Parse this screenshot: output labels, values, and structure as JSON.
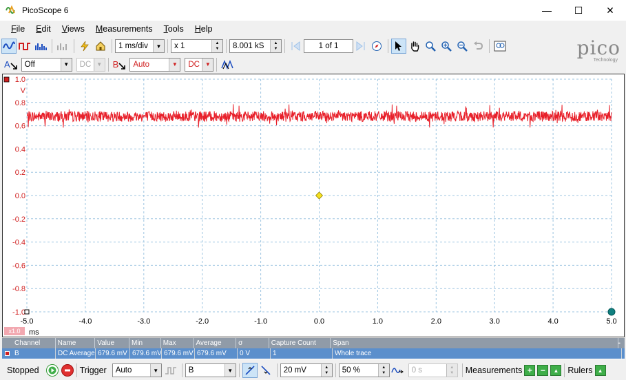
{
  "window": {
    "title": "PicoScope 6",
    "minimize": "—",
    "maximize": "☐",
    "close": "✕"
  },
  "menu": [
    {
      "label": "File",
      "u": "F",
      "rest": "ile"
    },
    {
      "label": "Edit",
      "u": "E",
      "rest": "dit"
    },
    {
      "label": "Views",
      "u": "V",
      "rest": "iews"
    },
    {
      "label": "Measurements",
      "u": "M",
      "rest": "easurements"
    },
    {
      "label": "Tools",
      "u": "T",
      "rest": "ools"
    },
    {
      "label": "Help",
      "u": "H",
      "rest": "elp"
    }
  ],
  "toolbar": {
    "timebase": "1 ms/div",
    "zoom": "x 1",
    "samples": "8.001 kS",
    "capture_index": "1 of 1"
  },
  "channels": {
    "a_label": "A",
    "a_range": "Off",
    "a_coupling": "DC",
    "b_label": "B",
    "b_range": "Auto",
    "b_coupling": "DC"
  },
  "logo": {
    "word": "pico",
    "sub": "Technology"
  },
  "scope": {
    "y_unit": "V",
    "y_ticks": [
      "1.0",
      "0.8",
      "0.6",
      "0.4",
      "0.2",
      "0.0",
      "-0.2",
      "-0.4",
      "-0.6",
      "-0.8",
      "-1.0"
    ],
    "x_ticks": [
      "-5.0",
      "-4.0",
      "-3.0",
      "-2.0",
      "-1.0",
      "0.0",
      "1.0",
      "2.0",
      "3.0",
      "4.0",
      "5.0"
    ],
    "x_unit": "ms",
    "zoom_badge": "x1.0",
    "trace_color": "#e8202a"
  },
  "chart_data": {
    "type": "line",
    "xlim": [
      -5.0,
      5.0
    ],
    "ylim": [
      -1.0,
      1.0
    ],
    "xlabel": "ms",
    "ylabel": "V",
    "series": [
      {
        "name": "B",
        "mean": 0.68,
        "noise_min": 0.56,
        "noise_max": 0.79
      }
    ],
    "trigger": {
      "x": 0.0,
      "y": 0.0
    }
  },
  "measurements": {
    "headers": [
      "Channel",
      "Name",
      "Value",
      "Min",
      "Max",
      "Average",
      "σ",
      "Capture Count",
      "Span"
    ],
    "rows": [
      [
        "B",
        "DC Average",
        "679.6 mV",
        "679.6 mV",
        "679.6 mV",
        "679.6 mV",
        "0 V",
        "1",
        "Whole trace"
      ]
    ]
  },
  "status": {
    "state": "Stopped",
    "trigger_label": "Trigger",
    "trigger_mode": "Auto",
    "trigger_channel": "B",
    "threshold": "20 mV",
    "pretrigger": "50 %",
    "delay": "0 s",
    "measurements_label": "Measurements",
    "rulers_label": "Rulers"
  }
}
